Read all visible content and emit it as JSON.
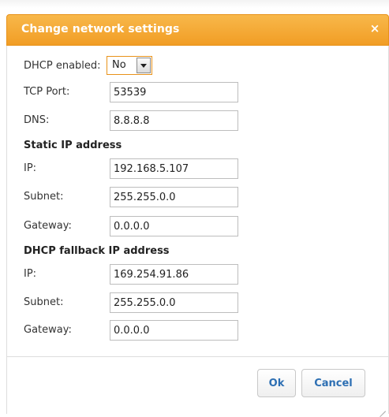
{
  "dialog": {
    "title": "Change network settings",
    "close_icon": "close-icon",
    "close_glyph": "×"
  },
  "form": {
    "dhcp": {
      "label": "DHCP enabled:",
      "value": "No",
      "options": [
        "No"
      ]
    },
    "tcp_port": {
      "label": "TCP Port:",
      "value": "53539"
    },
    "dns": {
      "label": "DNS:",
      "value": "8.8.8.8"
    },
    "static": {
      "heading": "Static IP address",
      "ip": {
        "label": "IP:",
        "value": "192.168.5.107"
      },
      "subnet": {
        "label": "Subnet:",
        "value": "255.255.0.0"
      },
      "gateway": {
        "label": "Gateway:",
        "value": "0.0.0.0"
      }
    },
    "fallback": {
      "heading": "DHCP fallback IP address",
      "ip": {
        "label": "IP:",
        "value": "169.254.91.86"
      },
      "subnet": {
        "label": "Subnet:",
        "value": "255.255.0.0"
      },
      "gateway": {
        "label": "Gateway:",
        "value": "0.0.0.0"
      }
    }
  },
  "buttons": {
    "ok": "Ok",
    "cancel": "Cancel"
  },
  "colors": {
    "title_bar": "#f19d25",
    "button_text": "#2d6fb3",
    "select_focus_border": "#e8921a"
  }
}
